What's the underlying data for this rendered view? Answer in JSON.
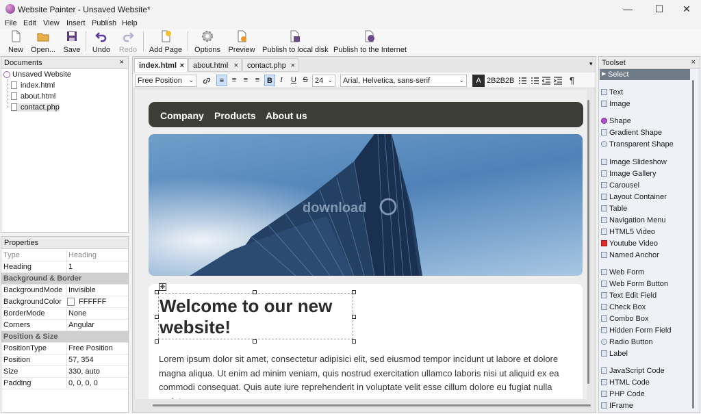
{
  "window": {
    "title": "Website Painter - Unsaved Website*",
    "minimize": "—",
    "maximize": "☐",
    "close": "✕"
  },
  "menu": [
    "File",
    "Edit",
    "View",
    "Insert",
    "Publish",
    "Help"
  ],
  "toolbar": [
    {
      "label": "New",
      "icon": "new-icon"
    },
    {
      "label": "Open...",
      "icon": "open-folder-icon"
    },
    {
      "label": "Save",
      "icon": "save-icon"
    },
    {
      "label": "Undo",
      "icon": "undo-icon"
    },
    {
      "label": "Redo",
      "icon": "redo-icon"
    },
    {
      "label": "Add Page",
      "icon": "add-page-icon"
    },
    {
      "label": "Options",
      "icon": "gear-icon"
    },
    {
      "label": "Preview",
      "icon": "preview-icon"
    },
    {
      "label": "Publish to local disk",
      "icon": "publish-disk-icon"
    },
    {
      "label": "Publish to the Internet",
      "icon": "publish-internet-icon"
    }
  ],
  "documents": {
    "title": "Documents",
    "close": "×",
    "root": "Unsaved Website",
    "files": [
      "index.html",
      "about.html",
      "contact.php"
    ]
  },
  "properties": {
    "title": "Properties",
    "rows": [
      {
        "key": "Type",
        "value": "Heading",
        "muted": true
      },
      {
        "key": "Heading",
        "value": "1"
      },
      {
        "section": "Background & Border"
      },
      {
        "key": "BackgroundMode",
        "value": "Invisible"
      },
      {
        "key": "BackgroundColor",
        "value": "FFFFFF",
        "swatch": "#FFFFFF"
      },
      {
        "key": "BorderMode",
        "value": "None"
      },
      {
        "key": "Corners",
        "value": "Angular"
      },
      {
        "section": "Position & Size"
      },
      {
        "key": "PositionType",
        "value": "Free Position"
      },
      {
        "key": "Position",
        "value": "57, 354"
      },
      {
        "key": "Size",
        "value": "330, auto"
      },
      {
        "key": "Padding",
        "value": "0, 0, 0, 0"
      }
    ]
  },
  "tabs": [
    {
      "label": "index.html",
      "active": true
    },
    {
      "label": "about.html"
    },
    {
      "label": "contact.php"
    }
  ],
  "tab_close": "×",
  "tabs_menu": "▾",
  "format": {
    "position": "Free Position",
    "font_size": "24",
    "font_family": "Arial, Helvetica, sans-serif",
    "color_letter": "A",
    "color_value": "2B2B2B",
    "align_left": "≡",
    "align_center": "≡",
    "align_right": "≡",
    "align_justify": "≡",
    "bold": "B",
    "italic": "I",
    "underline": "U",
    "strike": "S",
    "pilcrow": "¶"
  },
  "canvas": {
    "nav": [
      "Company",
      "Products",
      "About us"
    ],
    "watermark": "download",
    "heading": "Welcome to our new website!",
    "paragraph": "Lorem ipsum dolor sit amet, consectetur adipisici elit, sed eiusmod tempor incidunt ut labore et dolore magna aliqua. Ut enim ad minim veniam, quis nostrud exercitation ullamco laboris nisi ut aliquid ex ea commodi consequat. Quis aute iure reprehenderit in voluptate velit esse cillum dolore eu fugiat nulla pariatur."
  },
  "toolset": {
    "title": "Toolset",
    "close": "×",
    "selected": "Select",
    "groups": [
      [
        "Text",
        "Image"
      ],
      [
        "Shape",
        "Gradient Shape",
        "Transparent Shape"
      ],
      [
        "Image Slideshow",
        "Image Gallery",
        "Carousel",
        "Layout Container",
        "Table",
        "Navigation Menu",
        "HTML5 Video",
        "Youtube Video",
        "Named Anchor"
      ],
      [
        "Web Form",
        "Web Form Button",
        "Text Edit Field",
        "Check Box",
        "Combo Box",
        "Hidden Form Field",
        "Radio Button",
        "Label"
      ],
      [
        "JavaScript Code",
        "HTML Code",
        "PHP Code",
        "IFrame"
      ]
    ]
  },
  "colors": {
    "nav_bg": "#3d3d38",
    "accent": "#0a5cc2",
    "selected_tool": "#707b88"
  }
}
